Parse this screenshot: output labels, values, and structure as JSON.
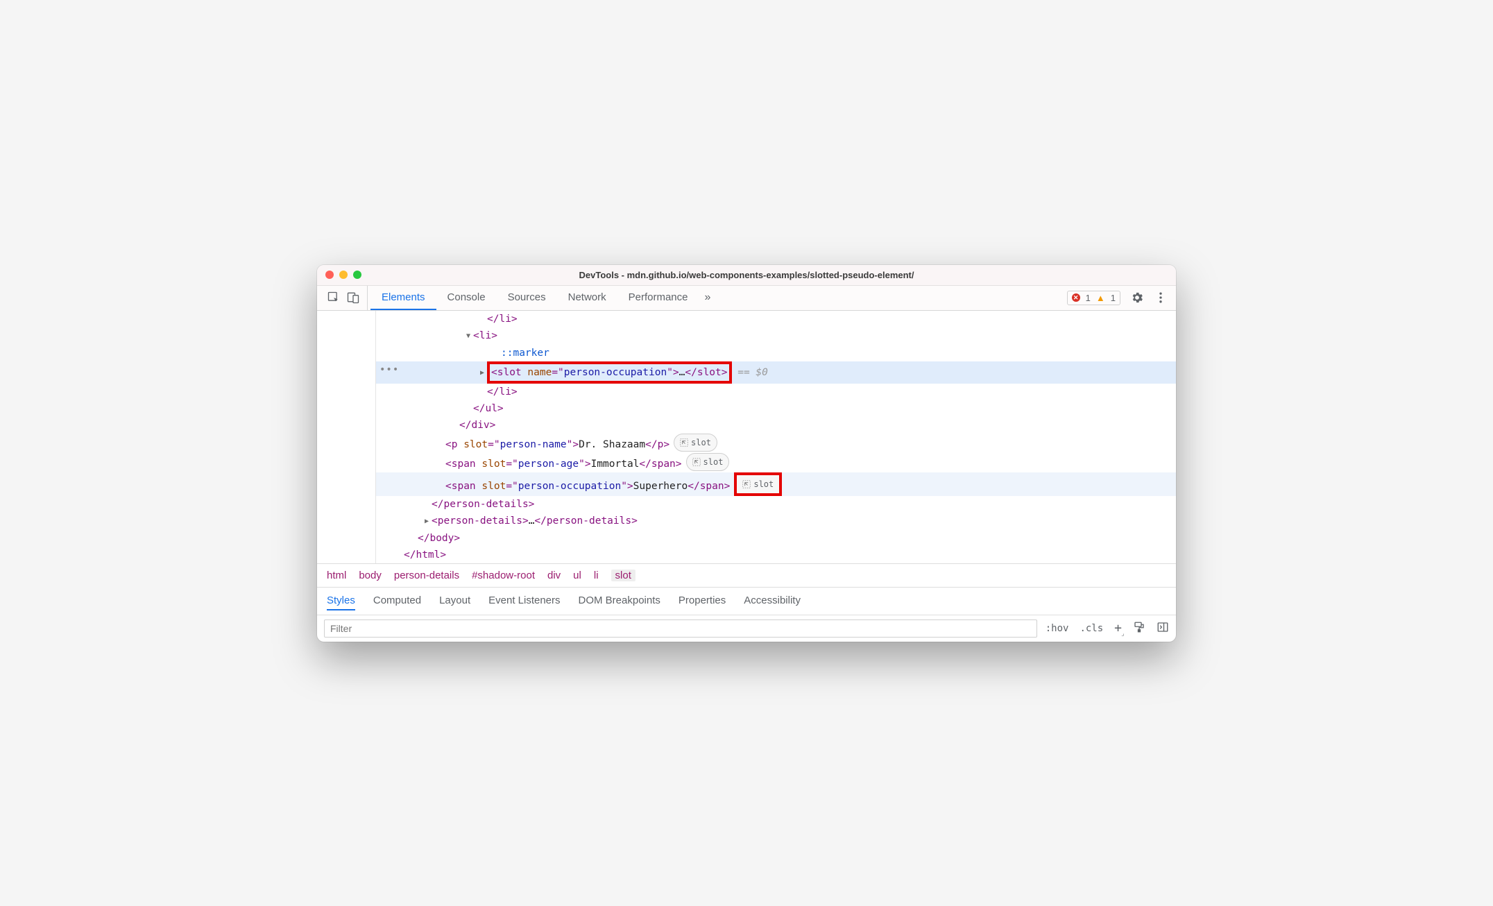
{
  "window": {
    "title": "DevTools - mdn.github.io/web-components-examples/slotted-pseudo-element/"
  },
  "toolbar": {
    "tabs": [
      "Elements",
      "Console",
      "Sources",
      "Network",
      "Performance"
    ],
    "active_tab": "Elements",
    "error_count": "1",
    "warning_count": "1"
  },
  "dom": {
    "indent_unit": "  ",
    "lines": [
      {
        "indent": 6,
        "parts": [
          {
            "t": "tag",
            "v": "</li>"
          }
        ]
      },
      {
        "indent": 5,
        "tri": "down",
        "parts": [
          {
            "t": "tag",
            "v": "<li>"
          }
        ]
      },
      {
        "indent": 7,
        "parts": [
          {
            "t": "pseudo",
            "v": "::marker"
          }
        ]
      },
      {
        "indent": 6,
        "tri": "right",
        "selected": true,
        "gutdots": true,
        "redbox": true,
        "parts": [
          {
            "t": "tag",
            "v": "<slot "
          },
          {
            "t": "attr-name",
            "v": "name"
          },
          {
            "t": "tag",
            "v": "=\""
          },
          {
            "t": "attr-val",
            "v": "person-occupation"
          },
          {
            "t": "tag",
            "v": "\">"
          },
          {
            "t": "txt",
            "v": "…"
          },
          {
            "t": "tag",
            "v": "</slot>"
          }
        ],
        "suffix": " == $0"
      },
      {
        "indent": 6,
        "parts": [
          {
            "t": "tag",
            "v": "</li>"
          }
        ]
      },
      {
        "indent": 5,
        "parts": [
          {
            "t": "tag",
            "v": "</ul>"
          }
        ]
      },
      {
        "indent": 4,
        "parts": [
          {
            "t": "tag",
            "v": "</div>"
          }
        ]
      },
      {
        "indent": 3,
        "slot": "plain",
        "parts": [
          {
            "t": "tag",
            "v": "<p "
          },
          {
            "t": "attr-name",
            "v": "slot"
          },
          {
            "t": "tag",
            "v": "=\""
          },
          {
            "t": "attr-val",
            "v": "person-name"
          },
          {
            "t": "tag",
            "v": "\">"
          },
          {
            "t": "txt",
            "v": "Dr. Shazaam"
          },
          {
            "t": "tag",
            "v": "</p>"
          }
        ]
      },
      {
        "indent": 3,
        "slot": "plain",
        "parts": [
          {
            "t": "tag",
            "v": "<span "
          },
          {
            "t": "attr-name",
            "v": "slot"
          },
          {
            "t": "tag",
            "v": "=\""
          },
          {
            "t": "attr-val",
            "v": "person-age"
          },
          {
            "t": "tag",
            "v": "\">"
          },
          {
            "t": "txt",
            "v": "Immortal"
          },
          {
            "t": "tag",
            "v": "</span>"
          }
        ]
      },
      {
        "indent": 3,
        "hover": true,
        "slot": "boxed",
        "parts": [
          {
            "t": "tag",
            "v": "<span "
          },
          {
            "t": "attr-name",
            "v": "slot"
          },
          {
            "t": "tag",
            "v": "=\""
          },
          {
            "t": "attr-val",
            "v": "person-occupation"
          },
          {
            "t": "tag",
            "v": "\">"
          },
          {
            "t": "txt",
            "v": "Superhero"
          },
          {
            "t": "tag",
            "v": "</span>"
          }
        ]
      },
      {
        "indent": 2,
        "parts": [
          {
            "t": "tag",
            "v": "</person-details>"
          }
        ]
      },
      {
        "indent": 2,
        "tri": "right",
        "parts": [
          {
            "t": "tag",
            "v": "<person-details>"
          },
          {
            "t": "txt",
            "v": "…"
          },
          {
            "t": "tag",
            "v": "</person-details>"
          }
        ]
      },
      {
        "indent": 1,
        "parts": [
          {
            "t": "tag",
            "v": "</body>"
          }
        ]
      },
      {
        "indent": 0,
        "parts": [
          {
            "t": "tag",
            "v": "</html>"
          }
        ]
      }
    ],
    "slot_pill_label": "slot"
  },
  "breadcrumb": [
    "html",
    "body",
    "person-details",
    "#shadow-root",
    "div",
    "ul",
    "li",
    "slot"
  ],
  "breadcrumb_active": "slot",
  "subtabs": [
    "Styles",
    "Computed",
    "Layout",
    "Event Listeners",
    "DOM Breakpoints",
    "Properties",
    "Accessibility"
  ],
  "subtabs_active": "Styles",
  "filter": {
    "placeholder": "Filter",
    "hov": ":hov",
    "cls": ".cls"
  }
}
